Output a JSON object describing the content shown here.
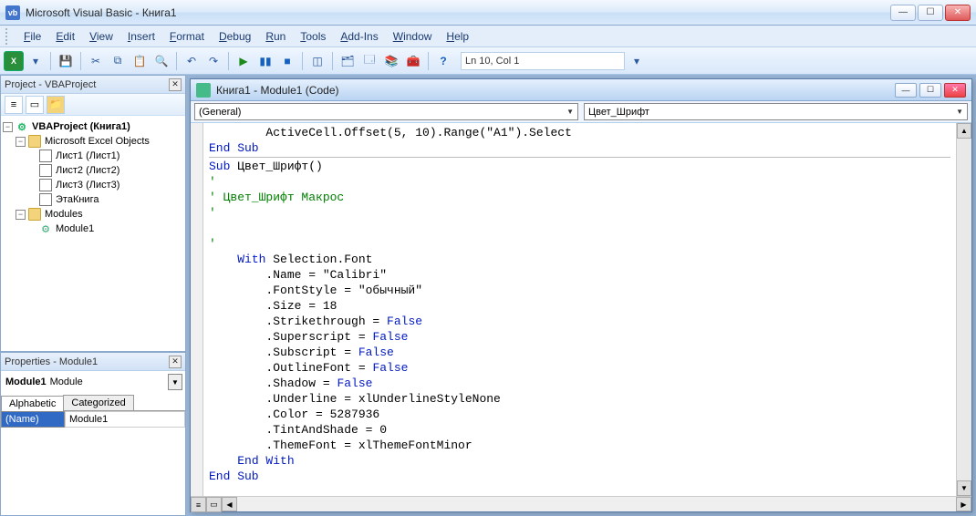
{
  "title": "Microsoft Visual Basic - Книга1",
  "menu": [
    "File",
    "Edit",
    "View",
    "Insert",
    "Format",
    "Debug",
    "Run",
    "Tools",
    "Add-Ins",
    "Window",
    "Help"
  ],
  "status_position": "Ln 10, Col 1",
  "project_panel": {
    "title": "Project - VBAProject",
    "root": "VBAProject (Книга1)",
    "excel_objects_label": "Microsoft Excel Objects",
    "sheets": [
      "Лист1 (Лист1)",
      "Лист2 (Лист2)",
      "Лист3 (Лист3)",
      "ЭтаКнига"
    ],
    "modules_label": "Modules",
    "modules": [
      "Module1"
    ]
  },
  "properties_panel": {
    "title": "Properties - Module1",
    "object_name": "Module1",
    "object_type": "Module",
    "tabs": [
      "Alphabetic",
      "Categorized"
    ],
    "rows": [
      {
        "name": "(Name)",
        "value": "Module1"
      }
    ]
  },
  "code_window": {
    "title": "Книга1 - Module1 (Code)",
    "dropdown_left": "(General)",
    "dropdown_right": "Цвет_Шрифт",
    "code_tokens": [
      [
        {
          "t": "        ActiveCell.Offset(5, 10).Range(\"A1\").Select"
        }
      ],
      [
        {
          "t": "End Sub",
          "c": "kw"
        }
      ],
      "hr",
      [
        {
          "t": "Sub ",
          "c": "kw"
        },
        {
          "t": "Цвет_Шрифт()"
        }
      ],
      [
        {
          "t": "'",
          "c": "com"
        }
      ],
      [
        {
          "t": "' Цвет_Шрифт Макрос",
          "c": "com"
        }
      ],
      [
        {
          "t": "'",
          "c": "com"
        }
      ],
      [
        {
          "t": ""
        }
      ],
      [
        {
          "t": "'",
          "c": "com"
        }
      ],
      [
        {
          "t": "    "
        },
        {
          "t": "With ",
          "c": "kw"
        },
        {
          "t": "Selection.Font"
        }
      ],
      [
        {
          "t": "        .Name = \"Calibri\""
        }
      ],
      [
        {
          "t": "        .FontStyle = \"обычный\""
        }
      ],
      [
        {
          "t": "        .Size = 18"
        }
      ],
      [
        {
          "t": "        .Strikethrough = "
        },
        {
          "t": "False",
          "c": "kw"
        }
      ],
      [
        {
          "t": "        .Superscript = "
        },
        {
          "t": "False",
          "c": "kw"
        }
      ],
      [
        {
          "t": "        .Subscript = "
        },
        {
          "t": "False",
          "c": "kw"
        }
      ],
      [
        {
          "t": "        .OutlineFont = "
        },
        {
          "t": "False",
          "c": "kw"
        }
      ],
      [
        {
          "t": "        .Shadow = "
        },
        {
          "t": "False",
          "c": "kw"
        }
      ],
      [
        {
          "t": "        .Underline = xlUnderlineStyleNone"
        }
      ],
      [
        {
          "t": "        .Color = 5287936"
        }
      ],
      [
        {
          "t": "        .TintAndShade = 0"
        }
      ],
      [
        {
          "t": "        .ThemeFont = xlThemeFontMinor"
        }
      ],
      [
        {
          "t": "    "
        },
        {
          "t": "End With",
          "c": "kw"
        }
      ],
      [
        {
          "t": "End Sub",
          "c": "kw"
        }
      ]
    ]
  },
  "toolbar_icons": [
    "xl",
    "save",
    "cut",
    "copy",
    "paste",
    "find",
    "undo",
    "redo",
    "run",
    "break",
    "stop",
    "design",
    "prj",
    "props",
    "browser",
    "toolbox",
    "help"
  ]
}
